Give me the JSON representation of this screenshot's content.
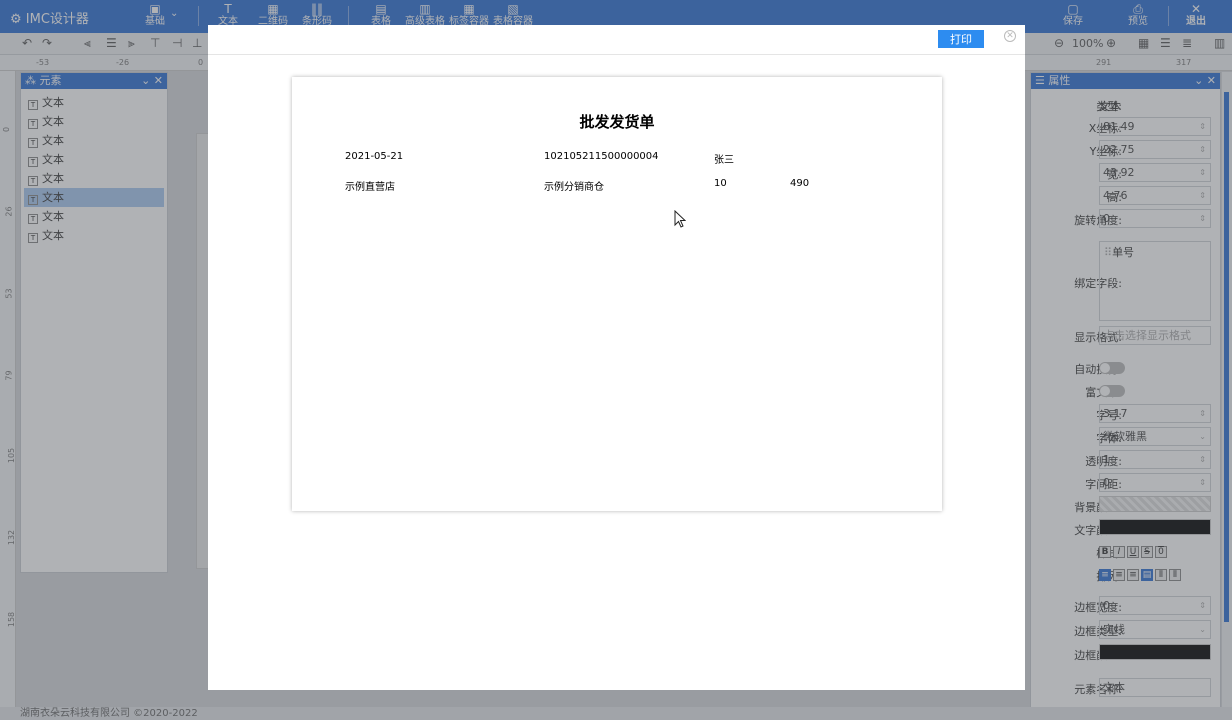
{
  "app": {
    "title": "IMC设计器"
  },
  "toolbar": {
    "basic_label": "基础",
    "text_label": "文本",
    "qrcode_label": "二维码",
    "barcode_label": "条形码",
    "table_label": "表格",
    "adv_table_label": "高级表格",
    "label_container_label": "标签容器",
    "table_container_label": "表格容器",
    "save_label": "保存",
    "preview_label": "预览",
    "exit_label": "退出",
    "zoom_label": "100%"
  },
  "ruler": {
    "h": [
      "-53",
      "-26",
      "0",
      "291",
      "317"
    ],
    "v": [
      "0",
      "26",
      "53",
      "79",
      "105",
      "132",
      "158"
    ]
  },
  "left_panel": {
    "title": "元素",
    "items": [
      "文本",
      "文本",
      "文本",
      "文本",
      "文本",
      "文本",
      "文本",
      "文本"
    ],
    "selected_index": 5
  },
  "right_panel": {
    "title": "属性",
    "type_label": "类型:",
    "type_value": "文本",
    "x_label": "X坐标:",
    "x_value": "81.49",
    "y_label": "Y坐标:",
    "y_value": "22.75",
    "w_label": "宽:",
    "w_value": "43.92",
    "h_label": "高:",
    "h_value": "4.76",
    "rot_label": "旋转角度:",
    "rot_value": "0",
    "bind_label": "绑定字段:",
    "bind_value": "单号",
    "fmt_label": "显示格式:",
    "fmt_placeholder": "点击选择显示格式",
    "wrap_label": "自动换行:",
    "rich_label": "富文本:",
    "fontsize_label": "字号:",
    "fontsize_value": "3.17",
    "font_label": "字体:",
    "font_value": "微软雅黑",
    "opacity_label": "透明度:",
    "opacity_value": "1",
    "spacing_label": "字间距:",
    "spacing_value": "0",
    "bg_label": "背景颜色:",
    "fg_label": "文字颜色:",
    "style_label": "样式:",
    "style_icons": [
      "B",
      "I",
      "U",
      "S",
      "0"
    ],
    "align_label": "排列:",
    "border_w_label": "边框宽度:",
    "border_w_value": "0",
    "border_t_label": "边框类型:",
    "border_t_value": "实线",
    "border_c_label": "边框颜色:",
    "name_label": "元素名称:",
    "name_value": "文本"
  },
  "status": {
    "copyright": "湖南衣朵云科技有限公司 ©2020-2022"
  },
  "modal": {
    "print_label": "打印",
    "close_glyph": "✕",
    "doc_title": "批发发货单",
    "row1": [
      "2021-05-21",
      "102105211500000004",
      "张三"
    ],
    "row2": [
      "示例直营店",
      "示例分销商仓",
      "10",
      "490"
    ]
  },
  "colors": {
    "accent": "#2d6fd4",
    "print_button": "#2d8cf0"
  }
}
